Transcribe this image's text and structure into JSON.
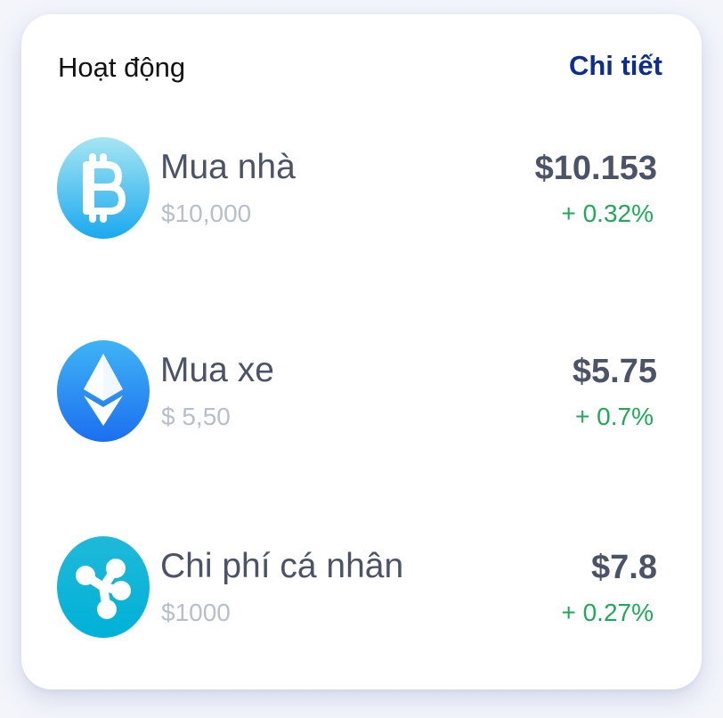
{
  "header": {
    "title": "Hoạt động",
    "details_link": "Chi tiết"
  },
  "items": [
    {
      "icon": "bitcoin-icon",
      "name": "Mua nhà",
      "amount": "$10,000",
      "value": "$10.153",
      "change": "+ 0.32%",
      "colors": {
        "gradient_top": "#a6e6f2",
        "gradient_bottom": "#1aa9ef"
      }
    },
    {
      "icon": "ethereum-icon",
      "name": "Mua xe",
      "amount": "$ 5,50",
      "value": "$5.75",
      "change": "+ 0.7%",
      "colors": {
        "gradient_top": "#3fb4f5",
        "gradient_bottom": "#1c6ff0"
      }
    },
    {
      "icon": "ripple-icon",
      "name": "Chi phí cá nhân",
      "amount": "$1000",
      "value": "$7.8",
      "change": "+ 0.27%",
      "colors": {
        "gradient_top": "#1fb9d9",
        "gradient_bottom": "#00b1d8"
      }
    }
  ],
  "colors": {
    "accent": "#0d2e8f",
    "positive": "#1faa5a",
    "primary_text": "#4b5466",
    "muted_text": "#b7bfcc"
  }
}
